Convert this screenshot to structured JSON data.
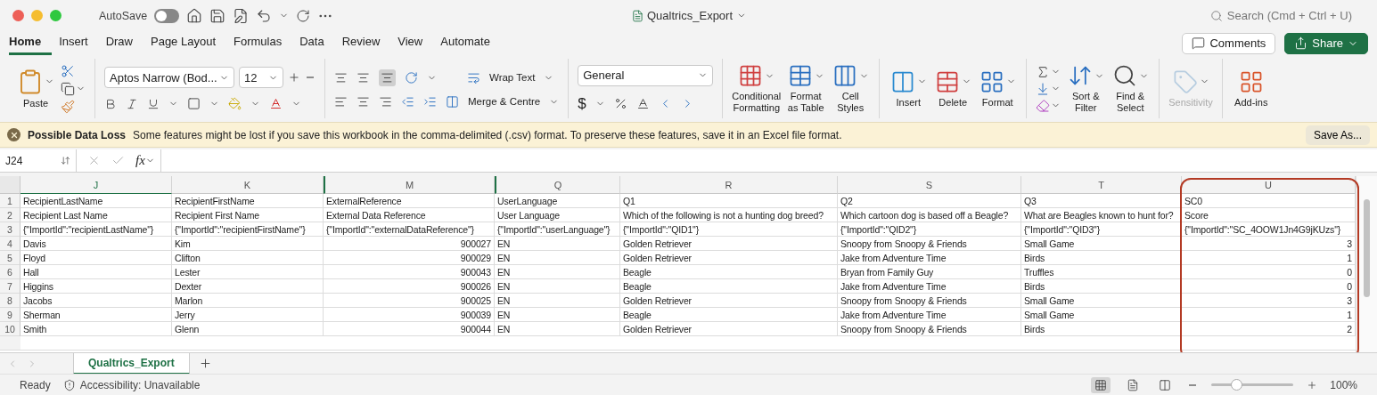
{
  "window": {
    "title": "Qualtrics_Export",
    "autosave": {
      "label": "AutoSave",
      "on": false
    },
    "search": {
      "placeholder": "Search (Cmd + Ctrl + U)"
    }
  },
  "ribbon_tabs": [
    {
      "label": "Home",
      "selected": true
    },
    {
      "label": "Insert",
      "selected": false
    },
    {
      "label": "Draw",
      "selected": false
    },
    {
      "label": "Page Layout",
      "selected": false
    },
    {
      "label": "Formulas",
      "selected": false
    },
    {
      "label": "Data",
      "selected": false
    },
    {
      "label": "Review",
      "selected": false
    },
    {
      "label": "View",
      "selected": false
    },
    {
      "label": "Automate",
      "selected": false
    }
  ],
  "header_buttons": {
    "comments": "Comments",
    "share": "Share"
  },
  "ribbon": {
    "paste": "Paste",
    "font_name": "Aptos Narrow (Bod...",
    "font_size": "12",
    "wrap_text": "Wrap Text",
    "merge": "Merge & Centre",
    "number_format": "General",
    "currency": "$",
    "align_bottom_selected": true,
    "big_buttons": [
      {
        "kind": "conditional",
        "lines": [
          "Conditional",
          "Formatting"
        ],
        "disabled": false
      },
      {
        "kind": "table",
        "lines": [
          "Format",
          "as Table"
        ],
        "disabled": false
      },
      {
        "kind": "styles",
        "lines": [
          "Cell",
          "Styles"
        ],
        "disabled": false
      },
      {
        "kind": "insert",
        "lines": [
          "Insert"
        ],
        "disabled": false
      },
      {
        "kind": "delete",
        "lines": [
          "Delete"
        ],
        "disabled": false
      },
      {
        "kind": "format",
        "lines": [
          "Format"
        ],
        "disabled": false
      },
      {
        "kind": "sort",
        "lines": [
          "Sort &",
          "Filter"
        ],
        "disabled": false
      },
      {
        "kind": "find",
        "lines": [
          "Find &",
          "Select"
        ],
        "disabled": false
      },
      {
        "kind": "sensitivity",
        "lines": [
          "Sensitivity"
        ],
        "disabled": true
      },
      {
        "kind": "addins",
        "lines": [
          "Add-ins"
        ],
        "disabled": false
      }
    ]
  },
  "message_bar": {
    "title": "Possible Data Loss",
    "text": "Some features might be lost if you save this workbook in the comma-delimited (.csv) format. To preserve these features, save it in an Excel file format.",
    "button": "Save As..."
  },
  "formula_bar": {
    "name_box": "J24",
    "function_label": "fx"
  },
  "sheet": {
    "columns": [
      {
        "label": "J",
        "selected": true,
        "hidden_before": false,
        "highlighted": false,
        "kind": "text"
      },
      {
        "label": "K",
        "selected": false,
        "hidden_before": false,
        "highlighted": false,
        "kind": "text"
      },
      {
        "label": "M",
        "selected": false,
        "hidden_before": true,
        "highlighted": false,
        "kind": "number"
      },
      {
        "label": "Q",
        "selected": false,
        "hidden_before": true,
        "highlighted": false,
        "kind": "text"
      },
      {
        "label": "R",
        "selected": false,
        "hidden_before": false,
        "highlighted": false,
        "kind": "text"
      },
      {
        "label": "S",
        "selected": false,
        "hidden_before": false,
        "highlighted": false,
        "kind": "text"
      },
      {
        "label": "T",
        "selected": false,
        "hidden_before": false,
        "highlighted": false,
        "kind": "text"
      },
      {
        "label": "U",
        "selected": false,
        "hidden_before": false,
        "highlighted": true,
        "kind": "number"
      }
    ],
    "rows": [
      {
        "number": "1",
        "kind": "header",
        "cells": [
          "RecipientLastName",
          "RecipientFirstName",
          "ExternalReference",
          "UserLanguage",
          "Q1",
          "Q2",
          "Q3",
          "SC0"
        ]
      },
      {
        "number": "2",
        "kind": "header",
        "cells": [
          "Recipient Last Name",
          "Recipient First Name",
          "External Data Reference",
          "User Language",
          "Which of the following is not a hunting dog breed?",
          "Which cartoon dog is based off a Beagle?",
          "What are Beagles known to hunt for?",
          "Score"
        ]
      },
      {
        "number": "3",
        "kind": "header",
        "cells": [
          "{\"ImportId\":\"recipientLastName\"}",
          "{\"ImportId\":\"recipientFirstName\"}",
          "{\"ImportId\":\"externalDataReference\"}",
          "{\"ImportId\":\"userLanguage\"}",
          "{\"ImportId\":\"QID1\"}",
          "{\"ImportId\":\"QID2\"}",
          "{\"ImportId\":\"QID3\"}",
          "{\"ImportId\":\"SC_4OOW1Jn4G9jKUzs\"}"
        ]
      },
      {
        "number": "4",
        "kind": "data",
        "cells": [
          "Davis",
          "Kim",
          "900027",
          "EN",
          "Golden Retriever",
          "Snoopy from Snoopy & Friends",
          "Small Game",
          "3"
        ]
      },
      {
        "number": "5",
        "kind": "data",
        "cells": [
          "Floyd",
          "Clifton",
          "900029",
          "EN",
          "Golden Retriever",
          "Jake from Adventure Time",
          "Birds",
          "1"
        ]
      },
      {
        "number": "6",
        "kind": "data",
        "cells": [
          "Hall",
          "Lester",
          "900043",
          "EN",
          "Beagle",
          "Bryan from Family Guy",
          "Truffles",
          "0"
        ]
      },
      {
        "number": "7",
        "kind": "data",
        "cells": [
          "Higgins",
          "Dexter",
          "900026",
          "EN",
          "Beagle",
          "Jake from Adventure Time",
          "Birds",
          "0"
        ]
      },
      {
        "number": "8",
        "kind": "data",
        "cells": [
          "Jacobs",
          "Marlon",
          "900025",
          "EN",
          "Golden Retriever",
          "Snoopy from Snoopy & Friends",
          "Small Game",
          "3"
        ]
      },
      {
        "number": "9",
        "kind": "data",
        "cells": [
          "Sherman",
          "Jerry",
          "900039",
          "EN",
          "Beagle",
          "Jake from Adventure Time",
          "Small Game",
          "1"
        ]
      },
      {
        "number": "10",
        "kind": "data",
        "cells": [
          "Smith",
          "Glenn",
          "900044",
          "EN",
          "Golden Retriever",
          "Snoopy from Snoopy & Friends",
          "Birds",
          "2"
        ]
      }
    ]
  },
  "sheet_tabs": [
    {
      "label": "Qualtrics_Export",
      "selected": true
    }
  ],
  "status_bar": {
    "status": "Ready",
    "accessibility": "Accessibility: Unavailable",
    "views": [
      {
        "kind": "normal",
        "selected": true
      },
      {
        "kind": "page",
        "selected": false
      },
      {
        "kind": "break",
        "selected": false
      }
    ],
    "zoom": "100%",
    "zoom_slider": {
      "level": 0.3
    }
  }
}
